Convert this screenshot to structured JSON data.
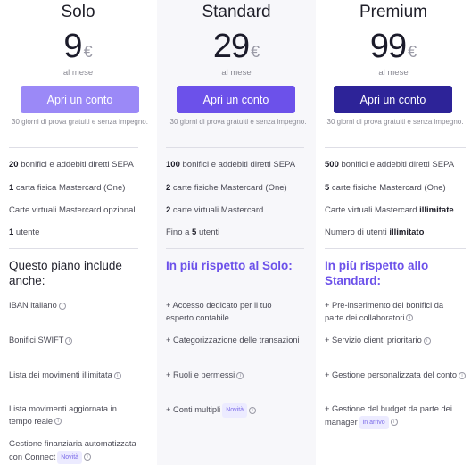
{
  "plans": {
    "solo": {
      "name": "Solo",
      "price": "9",
      "currency": "€",
      "period": "al mese",
      "cta": "Apri un conto",
      "trial": "30 giorni di prova gratuiti e senza impegno.",
      "features": [
        {
          "strong": "20",
          "text": " bonifici e addebiti diretti SEPA"
        },
        {
          "strong": "1",
          "text": " carta fisica Mastercard (One)"
        },
        {
          "strong": "",
          "text": "Carte virtuali Mastercard opzionali"
        },
        {
          "strong": "1",
          "text": " utente"
        }
      ],
      "includes_title": "Questo piano include anche:",
      "extras": [
        {
          "text": "IBAN italiano",
          "badge": ""
        },
        {
          "text": "Bonifici SWIFT",
          "badge": ""
        },
        {
          "text": "Lista dei movimenti illimitata",
          "badge": ""
        },
        {
          "text": "Lista movimenti aggiornata in tempo reale",
          "badge": ""
        },
        {
          "text": "Gestione finanziaria automatizzata con Connect",
          "badge": "Novità"
        }
      ]
    },
    "standard": {
      "name": "Standard",
      "price": "29",
      "currency": "€",
      "period": "al mese",
      "cta": "Apri un conto",
      "trial": "30 giorni di prova gratuiti e senza impegno.",
      "features": [
        {
          "pre": "",
          "strong": "100",
          "text": " bonifici e addebiti diretti SEPA"
        },
        {
          "pre": "",
          "strong": "2",
          "text": " carte fisiche Mastercard (One)"
        },
        {
          "pre": "",
          "strong": "2",
          "text": " carte virtuali Mastercard"
        },
        {
          "pre": "Fino a ",
          "strong": "5",
          "text": " utenti"
        }
      ],
      "includes_title": "In più rispetto al Solo:",
      "extras": [
        {
          "text": "+ Accesso dedicato per il tuo esperto contabile",
          "badge": ""
        },
        {
          "text": "+ Categorizzazione delle transazioni",
          "badge": ""
        },
        {
          "text": "+ Ruoli e permessi",
          "badge": ""
        },
        {
          "text": "+ Conti multipli",
          "badge": "Novità"
        }
      ]
    },
    "premium": {
      "name": "Premium",
      "price": "99",
      "currency": "€",
      "period": "al mese",
      "cta": "Apri un conto",
      "trial": "30 giorni di prova gratuiti e senza impegno.",
      "features": [
        {
          "pre": "",
          "strong": "500",
          "text": " bonifici e addebiti diretti SEPA"
        },
        {
          "pre": "",
          "strong": "5",
          "text": " carte fisiche Mastercard (One)"
        },
        {
          "pre": "Carte virtuali Mastercard ",
          "strong": "illimitate",
          "text": ""
        },
        {
          "pre": "Numero di utenti ",
          "strong": "illimitato",
          "text": ""
        }
      ],
      "includes_title": "In più rispetto allo Standard:",
      "extras": [
        {
          "text": "+ Pre-inserimento dei bonifici da parte dei collaboratori",
          "badge": ""
        },
        {
          "text": "+ Servizio clienti prioritario",
          "badge": ""
        },
        {
          "text": "+ Gestione personalizzata del conto",
          "badge": ""
        },
        {
          "text": "+ Gestione del budget da parte dei manager",
          "badge": "in arrivo"
        }
      ]
    }
  },
  "colors": {
    "solo_button": "#9b89f7",
    "standard_button": "#6c51ea",
    "premium_button": "#2d2398",
    "accent_heading": "#6c51ea"
  },
  "icons": {
    "info": "info-circle-icon"
  }
}
